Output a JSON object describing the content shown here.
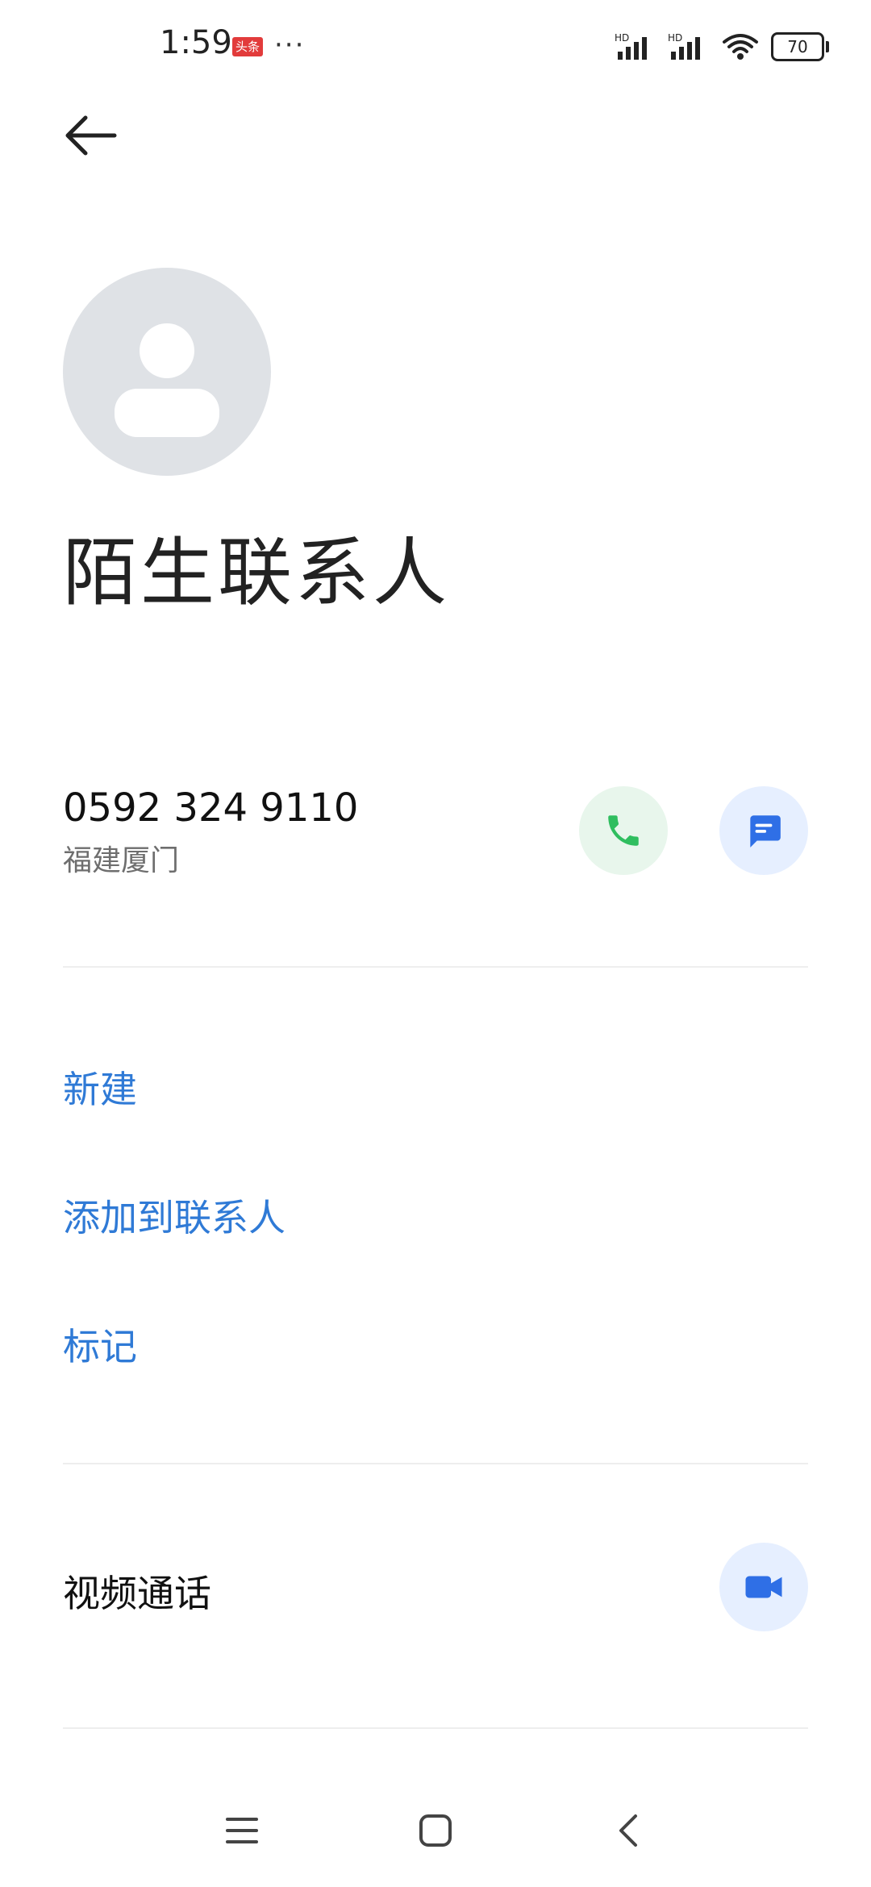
{
  "status_bar": {
    "time": "1:59",
    "badge": "头条",
    "more": "···",
    "battery": "70",
    "hd1": "HD",
    "hd2": "HD"
  },
  "contact": {
    "name": "陌生联系人",
    "phone": "0592 324 9110",
    "location": "福建厦门"
  },
  "actions": {
    "new": "新建",
    "add_to_contacts": "添加到联系人",
    "mark": "标记"
  },
  "video": {
    "label": "视频通话"
  },
  "colors": {
    "accent": "#2f7ad6",
    "call_green": "#2fbe5f",
    "message_blue": "#2f6fe6"
  },
  "icons": {
    "back": "arrow-left-icon",
    "avatar": "person-icon",
    "call": "phone-icon",
    "message": "message-icon",
    "video": "video-camera-icon",
    "nav_menu": "menu-icon",
    "nav_home": "home-square-icon",
    "nav_back": "chevron-left-icon"
  }
}
